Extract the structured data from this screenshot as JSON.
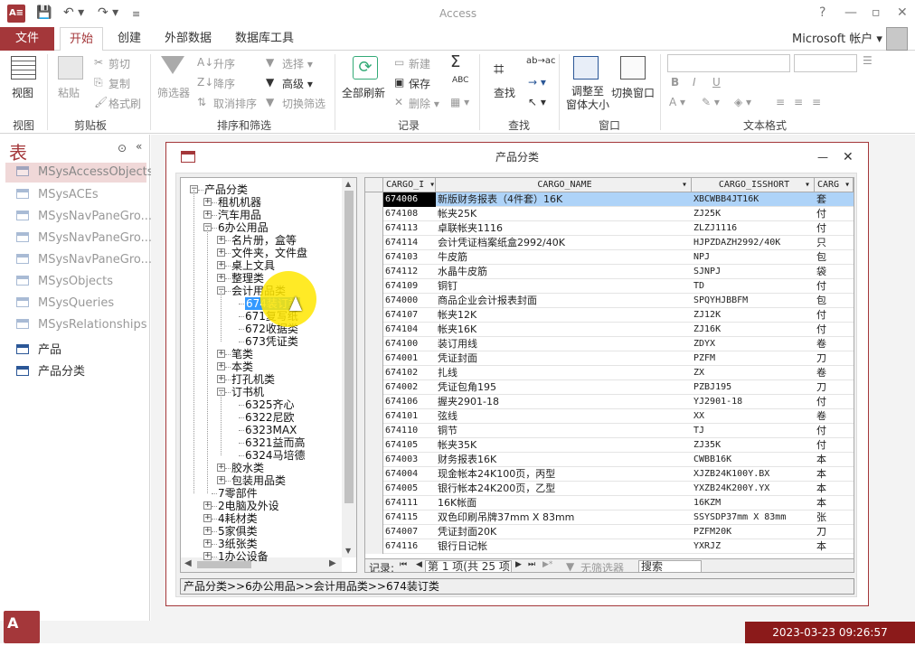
{
  "app": {
    "title": "Access",
    "icon_label": "A≡",
    "account": "Microsoft 帐户 ▾"
  },
  "qat": {
    "save": "💾",
    "undo": "↶ ▾",
    "redo": "↷ ▾",
    "more": "≡"
  },
  "window_controls": {
    "help": "?",
    "minimize": "—",
    "restore": "▫",
    "close": "✕"
  },
  "tabs": {
    "file": "文件",
    "home": "开始",
    "create": "创建",
    "external": "外部数据",
    "dbtools": "数据库工具"
  },
  "ribbon": {
    "view": "视图",
    "paste": "粘贴",
    "cut": "剪切",
    "copy": "复制",
    "painter": "格式刷",
    "filter": "筛选器",
    "asc": "升序",
    "desc": "降序",
    "clear_sort": "取消排序",
    "select": "选择 ▾",
    "advanced": "高级 ▾",
    "toggle_filter": "切换筛选",
    "refresh": "全部刷新",
    "new": "新建",
    "save": "保存",
    "delete": "删除 ▾",
    "totals": "Σ",
    "spelling": "ABC",
    "more": "▦ ▾",
    "find": "查找",
    "replace": "ab→ac",
    "goto": "→ ▾",
    "selectfind": "↖ ▾",
    "fit_form": "调整至\n窗体大小",
    "switch_window": "切换窗口",
    "g_view": "视图",
    "g_clipboard": "剪贴板",
    "g_sortfilter": "排序和筛选",
    "g_records": "记录",
    "g_find": "查找",
    "g_window": "窗口",
    "g_textfmt": "文本格式",
    "fmt_bold": "B",
    "fmt_italic": "I",
    "fmt_underline": "U"
  },
  "nav": {
    "header": "表",
    "items": [
      "MSysAccessObjects",
      "MSysACEs",
      "MSysNavPaneGro...",
      "MSysNavPaneGro...",
      "MSysNavPaneGro...",
      "MSysObjects",
      "MSysQueries",
      "MSysRelationships",
      "产品",
      "产品分类"
    ]
  },
  "form": {
    "title": "产品分类",
    "minimize": "—",
    "close": "✕",
    "tree": [
      {
        "label": "产品分类",
        "depth": 0,
        "box": "−"
      },
      {
        "label": "租机机器",
        "depth": 1,
        "box": "+"
      },
      {
        "label": "汽车用品",
        "depth": 1,
        "box": "+"
      },
      {
        "label": "6办公用品",
        "depth": 1,
        "box": "−"
      },
      {
        "label": "名片册，盒等",
        "depth": 2,
        "box": "+"
      },
      {
        "label": "文件夹，文件盘",
        "depth": 2,
        "box": "+"
      },
      {
        "label": "桌上文具",
        "depth": 2,
        "box": "+"
      },
      {
        "label": "整理类",
        "depth": 2,
        "box": "+"
      },
      {
        "label": "会计用品类",
        "depth": 2,
        "box": "−"
      },
      {
        "label": "674装订类",
        "depth": 3,
        "box": "",
        "sel": true
      },
      {
        "label": "671复写纸",
        "depth": 3,
        "box": ""
      },
      {
        "label": "672收据类",
        "depth": 3,
        "box": ""
      },
      {
        "label": "673凭证类",
        "depth": 3,
        "box": ""
      },
      {
        "label": "笔类",
        "depth": 2,
        "box": "+"
      },
      {
        "label": "本类",
        "depth": 2,
        "box": "+"
      },
      {
        "label": "打孔机类",
        "depth": 2,
        "box": "+"
      },
      {
        "label": "订书机",
        "depth": 2,
        "box": "−"
      },
      {
        "label": "6325齐心",
        "depth": 3,
        "box": ""
      },
      {
        "label": "6322尼欧",
        "depth": 3,
        "box": ""
      },
      {
        "label": "6323MAX",
        "depth": 3,
        "box": ""
      },
      {
        "label": "6321益而高",
        "depth": 3,
        "box": ""
      },
      {
        "label": "6324马培德",
        "depth": 3,
        "box": ""
      },
      {
        "label": "胶水类",
        "depth": 2,
        "box": "+"
      },
      {
        "label": "包装用品类",
        "depth": 2,
        "box": "+"
      },
      {
        "label": "7零部件",
        "depth": 1,
        "box": ""
      },
      {
        "label": "2电脑及外设",
        "depth": 1,
        "box": "+"
      },
      {
        "label": "4耗材类",
        "depth": 1,
        "box": "+"
      },
      {
        "label": "5家俱类",
        "depth": 1,
        "box": "+"
      },
      {
        "label": "3纸张类",
        "depth": 1,
        "box": "+"
      },
      {
        "label": "1办公设备",
        "depth": 1,
        "box": "+"
      }
    ],
    "columns": [
      "CARGO_I ▾",
      "CARGO_NAME",
      "CARGO_ISSHORT",
      "CARG ▾"
    ],
    "col_sort": [
      "",
      "▾",
      "▾",
      ""
    ],
    "rows": [
      [
        "674006",
        "新版财务报表（4件套）16K",
        "XBCWBB4JT16K",
        "套"
      ],
      [
        "674108",
        "帐夹25K",
        "ZJ25K",
        "付"
      ],
      [
        "674113",
        "卓联帐夹1116",
        "ZLZJ1116",
        "付"
      ],
      [
        "674114",
        "会计凭证档案纸盒2992/40K",
        "HJPZDAZH2992/40K",
        "只"
      ],
      [
        "674103",
        "牛皮筋",
        "NPJ",
        "包"
      ],
      [
        "674112",
        "水晶牛皮筋",
        "SJNPJ",
        "袋"
      ],
      [
        "674109",
        "铜钉",
        "TD",
        "付"
      ],
      [
        "674000",
        "商品企业会计报表封面",
        "SPQYHJBBFM",
        "包"
      ],
      [
        "674107",
        "帐夹12K",
        "ZJ12K",
        "付"
      ],
      [
        "674104",
        "帐夹16K",
        "ZJ16K",
        "付"
      ],
      [
        "674100",
        "装订用线",
        "ZDYX",
        "卷"
      ],
      [
        "674001",
        "凭证封面",
        "PZFM",
        "刀"
      ],
      [
        "674102",
        "扎线",
        "ZX",
        "卷"
      ],
      [
        "674002",
        "凭证包角195",
        "PZBJ195",
        "刀"
      ],
      [
        "674106",
        "握夹2901-18",
        "YJ2901-18",
        "付"
      ],
      [
        "674101",
        "弦线",
        "XX",
        "卷"
      ],
      [
        "674110",
        "铜节",
        "TJ",
        "付"
      ],
      [
        "674105",
        "帐夹35K",
        "ZJ35K",
        "付"
      ],
      [
        "674003",
        "财务报表16K",
        "CWBB16K",
        "本"
      ],
      [
        "674004",
        "现金帐本24K100页，丙型",
        "XJZB24K100Y.BX",
        "本"
      ],
      [
        "674005",
        "银行帐本24K200页，乙型",
        "YXZB24K200Y.YX",
        "本"
      ],
      [
        "674111",
        "16K帐面",
        "16KZM",
        "本"
      ],
      [
        "674115",
        "双色印刷吊牌37mm X 83mm",
        "SSYSDP37mm X 83mm",
        "张"
      ],
      [
        "674007",
        "凭证封面20K",
        "PZFM20K",
        "刀"
      ],
      [
        "674116",
        "银行日记帐",
        "YXRJZ",
        "本"
      ]
    ],
    "record_nav": {
      "label": "记录:",
      "first": "⏮",
      "prev": "◀",
      "position": "第 1 项(共 25 项",
      "next": "▶",
      "last": "⏭",
      "new": "▶*",
      "filter": "无筛选器",
      "search": "搜索"
    },
    "breadcrumb": "产品分类>>6办公用品>>会计用品类>>674装订类"
  },
  "timestamp": "2023-03-23 09:26:57 00:00.000",
  "badge": "A"
}
